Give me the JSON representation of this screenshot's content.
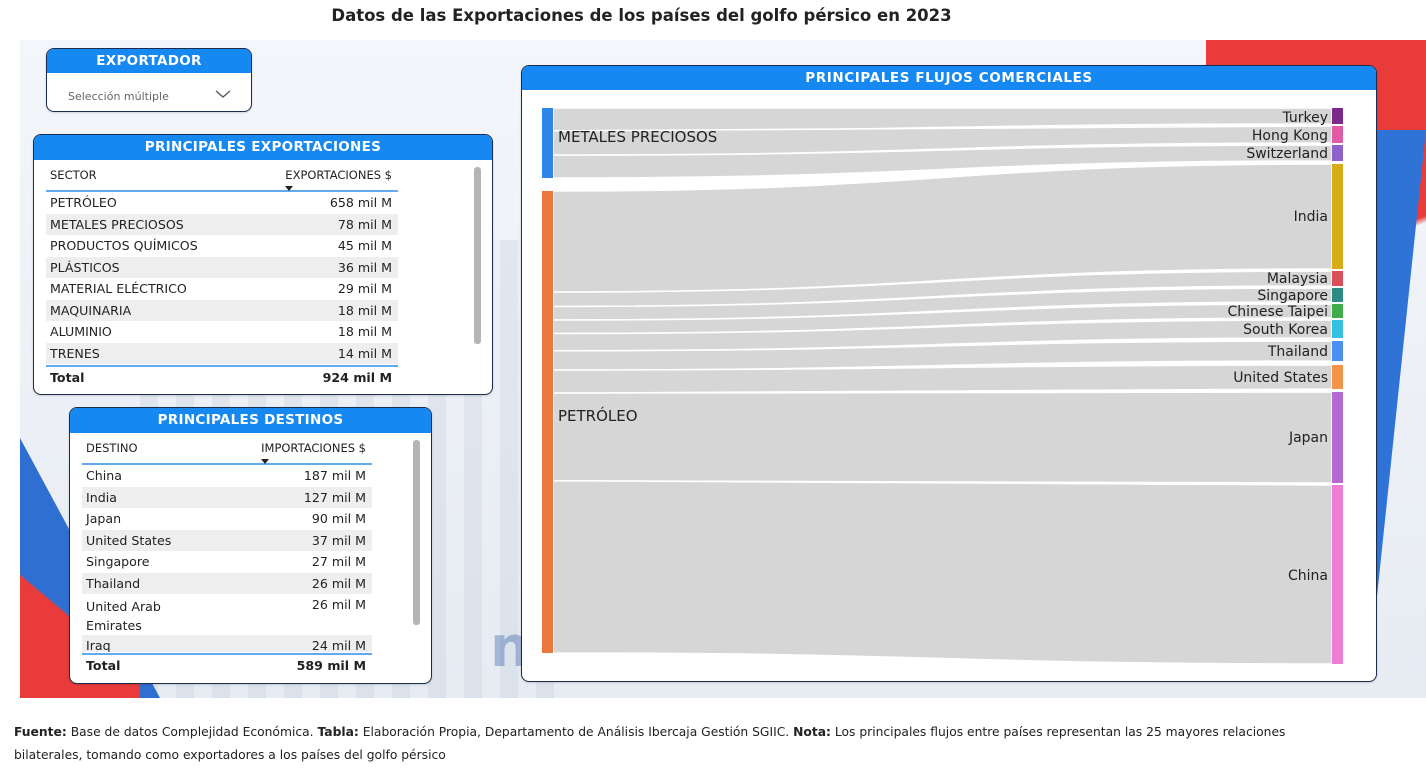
{
  "title": "Datos de las Exportaciones de los países del golfo pérsico en 2023",
  "filter": {
    "title": "EXPORTADOR",
    "value": "Selección múltiple"
  },
  "exports": {
    "title": "PRINCIPALES EXPORTACIONES",
    "col1": "SECTOR",
    "col2": "EXPORTACIONES $",
    "rows": [
      {
        "label": "PETRÓLEO",
        "value": "658 mil M"
      },
      {
        "label": "METALES PRECIOSOS",
        "value": "78 mil M"
      },
      {
        "label": "PRODUCTOS QUÍMICOS",
        "value": "45 mil M"
      },
      {
        "label": "PLÁSTICOS",
        "value": "36 mil M"
      },
      {
        "label": "MATERIAL ELÉCTRICO",
        "value": "29 mil M"
      },
      {
        "label": "MAQUINARIA",
        "value": "18 mil M"
      },
      {
        "label": "ALUMINIO",
        "value": "18 mil M"
      },
      {
        "label": "TRENES",
        "value": "14 mil M"
      }
    ],
    "total_label": "Total",
    "total_value": "924 mil M"
  },
  "destinations": {
    "title": "PRINCIPALES DESTINOS",
    "col1": "DESTINO",
    "col2": "IMPORTACIONES $",
    "rows": [
      {
        "label": "China",
        "value": "187 mil M"
      },
      {
        "label": "India",
        "value": "127 mil M"
      },
      {
        "label": "Japan",
        "value": "90 mil M"
      },
      {
        "label": "United States",
        "value": "37 mil M"
      },
      {
        "label": "Singapore",
        "value": "27 mil M"
      },
      {
        "label": "Thailand",
        "value": "26 mil M"
      },
      {
        "label": "United Arab Emirates",
        "value": "26 mil M"
      },
      {
        "label": "Iraq",
        "value": "24 mil M"
      }
    ],
    "total_label": "Total",
    "total_value": "589 mil M"
  },
  "flows": {
    "title": "PRINCIPALES FLUJOS COMERCIALES",
    "sources": [
      {
        "name": "METALES PRECIOSOS",
        "color": "#2f86e6"
      },
      {
        "name": "PETRÓLEO",
        "color": "#e97840"
      }
    ],
    "targets": [
      {
        "name": "Turkey",
        "color": "#7b2a8c"
      },
      {
        "name": "Hong Kong",
        "color": "#e05ba6"
      },
      {
        "name": "Switzerland",
        "color": "#8e63c9"
      },
      {
        "name": "India",
        "color": "#d6ad16"
      },
      {
        "name": "Malaysia",
        "color": "#d9505a"
      },
      {
        "name": "Singapore",
        "color": "#2e8b84"
      },
      {
        "name": "Chinese Taipei",
        "color": "#3fae4a"
      },
      {
        "name": "South Korea",
        "color": "#35c0e0"
      },
      {
        "name": "Thailand",
        "color": "#4d8ff0"
      },
      {
        "name": "United States",
        "color": "#f2954b"
      },
      {
        "name": "Japan",
        "color": "#b46ad0"
      },
      {
        "name": "China",
        "color": "#ee7dd6"
      }
    ]
  },
  "footer": {
    "source_label": "Fuente:",
    "source_text": " Base de datos Complejidad Económica. ",
    "table_label": "Tabla:",
    "table_text": " Elaboración Propia, Departamento de Análisis Ibercaja Gestión SGIIC. ",
    "note_label": "Nota:",
    "note_text": " Los principales flujos entre países representan las 25 mayores relaciones bilaterales, tomando como exportadores a los países del golfo pérsico"
  }
}
